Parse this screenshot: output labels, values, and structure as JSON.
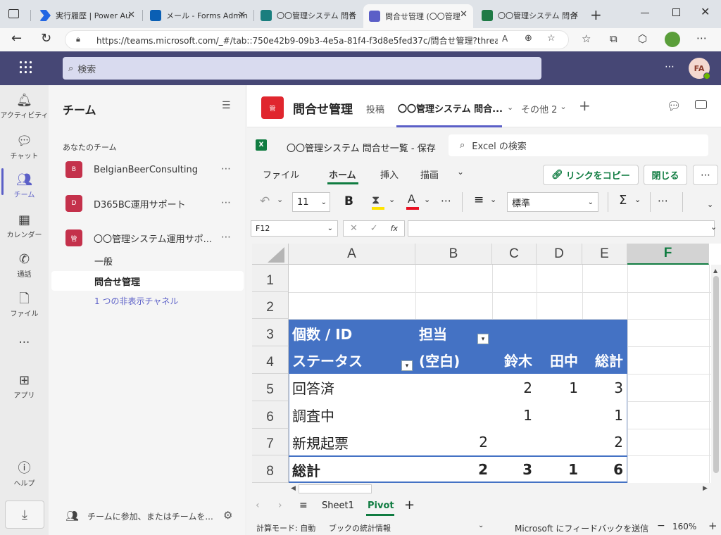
{
  "browser": {
    "tabs": [
      {
        "title": "実行履歴 | Power Au",
        "color": "#2266e3"
      },
      {
        "title": "メール - Forms Admin",
        "color": "#0a5fb4"
      },
      {
        "title": "〇〇管理システム 問合",
        "color": "#1a7e7e"
      },
      {
        "title": "問合せ管理 (〇〇管理",
        "color": "#5b5fc7"
      },
      {
        "title": "〇〇管理システム 問合",
        "color": "#1f7a45"
      }
    ],
    "url": "https://teams.microsoft.com/_#/tab::750e42b9-09b3-4e5a-81f4-f3d8e5fed37c/問合せ管理?threadI..."
  },
  "teams": {
    "search_placeholder": "検索",
    "avatar": "FA",
    "rail": [
      {
        "label": "アクティビティ",
        "icon": "bell-icon"
      },
      {
        "label": "チャット",
        "icon": "chat-icon"
      },
      {
        "label": "チーム",
        "icon": "teams-icon"
      },
      {
        "label": "カレンダー",
        "icon": "calendar-icon"
      },
      {
        "label": "通話",
        "icon": "phone-icon"
      },
      {
        "label": "ファイル",
        "icon": "file-icon"
      },
      {
        "label": "アプリ",
        "icon": "apps-icon"
      },
      {
        "label": "ヘルプ",
        "icon": "help-icon"
      }
    ],
    "panel_title": "チーム",
    "section_label": "あなたのチーム",
    "teams": [
      {
        "name": "BelgianBeerConsulting",
        "initial": "B"
      },
      {
        "name": "D365BC運用サポート",
        "initial": "D"
      },
      {
        "name": "〇〇管理システム運用サポ...",
        "initial": "管"
      }
    ],
    "channels": [
      "一般",
      "問合せ管理"
    ],
    "hidden_channels": "1 つの非表示チャネル",
    "join_label": "チームに参加、またはチームを..."
  },
  "channel": {
    "icon_text": "管",
    "title": "問合せ管理",
    "tabs": [
      "投稿",
      "〇〇管理システム 問合...",
      "その他 2"
    ]
  },
  "excel": {
    "file_title": "〇〇管理システム 問合せ一覧 - 保存",
    "search_placeholder": "Excel の検索",
    "ribbon_tabs": [
      "ファイル",
      "ホーム",
      "挿入",
      "描画"
    ],
    "copy_link": "リンクをコピー",
    "close": "閉じる",
    "font_size": "11",
    "number_format": "標準",
    "name_box": "F12",
    "fx": "fx",
    "columns": [
      "A",
      "B",
      "C",
      "D",
      "E",
      "F"
    ],
    "rows": [
      "1",
      "2",
      "3",
      "4",
      "5",
      "6",
      "7",
      "8"
    ],
    "pivot": {
      "header_label": "個数 / ID",
      "col_field": "担当",
      "row_field": "ステータス",
      "col_headers": [
        "(空白)",
        "鈴木",
        "田中",
        "総計"
      ],
      "rows": [
        {
          "label": "回答済",
          "values": [
            "",
            "2",
            "1",
            "3"
          ]
        },
        {
          "label": "調査中",
          "values": [
            "",
            "1",
            "",
            "1"
          ]
        },
        {
          "label": "新規起票",
          "values": [
            "2",
            "",
            "",
            "2"
          ]
        }
      ],
      "total": {
        "label": "総計",
        "values": [
          "2",
          "3",
          "1",
          "6"
        ]
      }
    },
    "sheets": [
      "Sheet1",
      "Pivot"
    ],
    "status_left": [
      "計算モード: 自動",
      "ブックの統計情報"
    ],
    "feedback": "Microsoft にフィードバックを送信",
    "zoom": "160%"
  },
  "colors": {
    "teams_header": "#464775",
    "pivot_blue": "#4472c4",
    "excel_green": "#107c41",
    "accent": "#5b5fc7"
  }
}
